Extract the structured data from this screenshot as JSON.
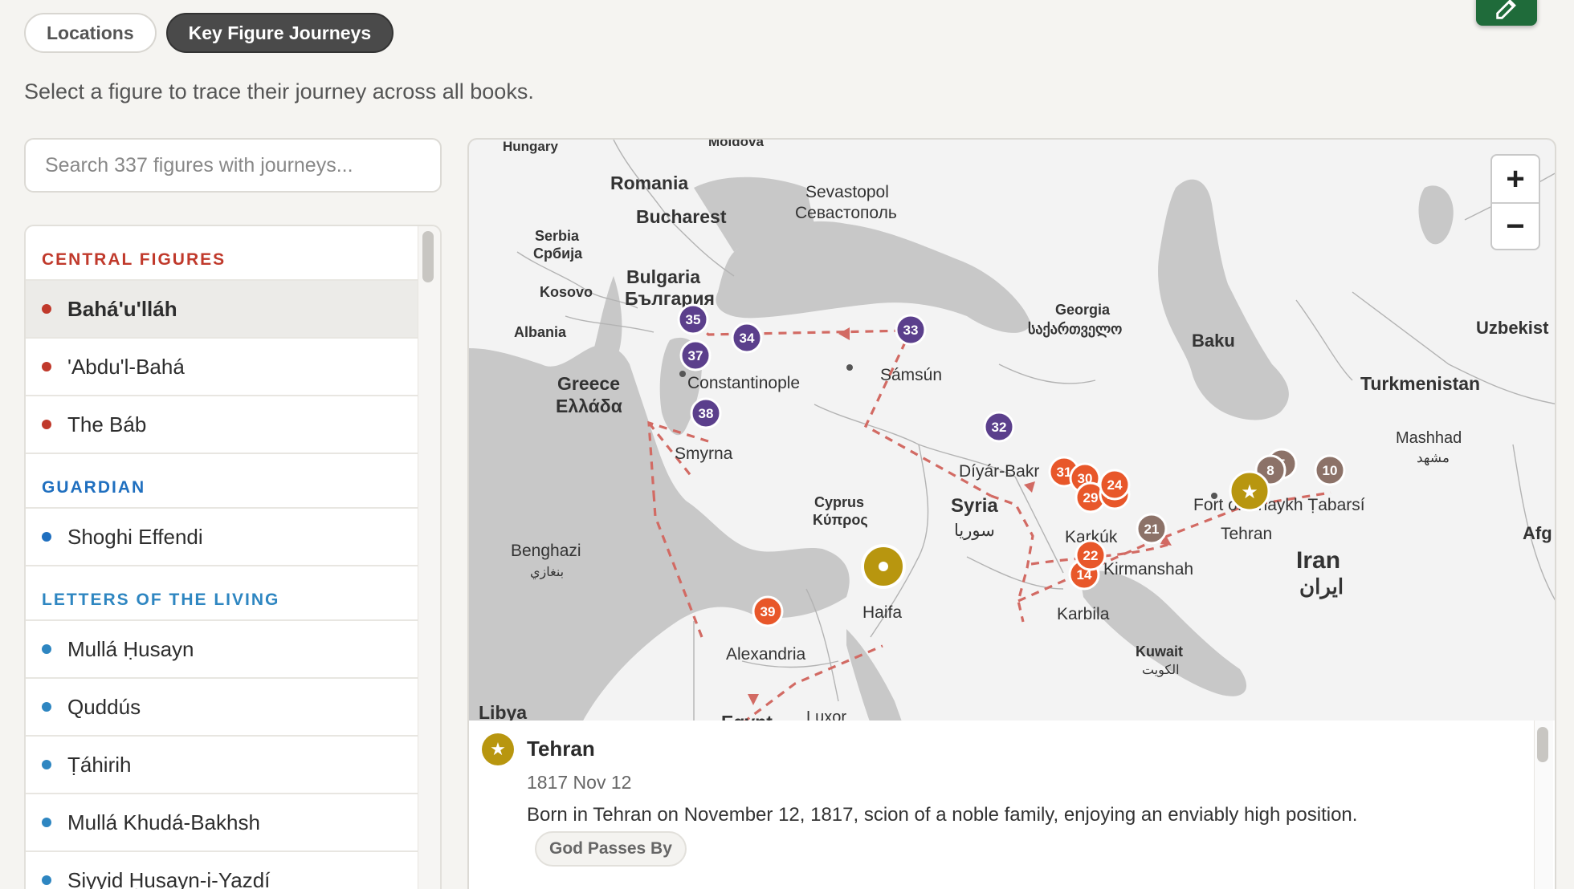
{
  "tabs": [
    {
      "label": "Locations",
      "active": false
    },
    {
      "label": "Key Figure Journeys",
      "active": true
    }
  ],
  "subtitle": "Select a figure to trace their journey across all books.",
  "search": {
    "placeholder": "Search 337 figures with journeys..."
  },
  "groups": [
    {
      "title": "CENTRAL FIGURES",
      "color": "#c0392b",
      "items": [
        "Bahá'u'lláh",
        "'Abdu'l-Bahá",
        "The Báb"
      ]
    },
    {
      "title": "GUARDIAN",
      "color": "#1f6fbf",
      "items": [
        "Shoghi Effendi"
      ]
    },
    {
      "title": "LETTERS OF THE LIVING",
      "color": "#2e86c1",
      "items": [
        "Mullá Ḥusayn",
        "Quddús",
        "Ṭáhirih",
        "Mullá Khudá-Bakhsh",
        "Siyyid Ḥusayn-i-Yazdí"
      ]
    }
  ],
  "selected_figure": "Bahá'u'lláh",
  "map": {
    "labels": {
      "hungary": "Hungary",
      "moldova": "Moldova",
      "romania": "Romania",
      "bucharest": "Bucharest",
      "sevastopol": "Sevastopol",
      "sevastopol_ru": "Севастополь",
      "serbia": "Serbia",
      "serbia_local": "Србија",
      "kosovo": "Kosovo",
      "bulgaria": "Bulgaria",
      "bulgaria_local": "България",
      "albania": "Albania",
      "greece": "Greece",
      "greece_local": "Ελλάδα",
      "constantinople": "Constantinople",
      "samsun": "Sámsún",
      "smyrna": "Smyrna",
      "georgia": "Georgia",
      "georgia_local": "საქართველო",
      "baku": "Baku",
      "uzbekistan": "Uzbekist",
      "turkmenistan": "Turkmenistan",
      "mashhad": "Mashhad",
      "mashhad_local": "مشهد",
      "diyar_bakr": "Díyár-Bakr",
      "syria": "Syria",
      "syria_local": "سوريا",
      "cyprus": "Cyprus",
      "cyprus_local": "Κύπρος",
      "benghazi": "Benghazi",
      "benghazi_local": "بنغازي",
      "haifa": "Haifa",
      "alexandria": "Alexandria",
      "karkuk": "Karkúk",
      "kirmanshah": "Kirmanshah",
      "karbila": "Karbila",
      "tehran": "Tehran",
      "fort": "Fort of Shaykh Ṭabarsí",
      "iran": "Iran",
      "iran_local": "ایران",
      "kuwait": "Kuwait",
      "kuwait_local": "الكويت",
      "libya": "Libya",
      "egypt": "Egypt",
      "luxor": "Luxor",
      "afg": "Afg"
    },
    "markers": {
      "m35": "35",
      "m34": "34",
      "m37": "37",
      "m38": "38",
      "m33": "33",
      "m32": "32",
      "m31": "31",
      "m30": "30",
      "m24": "24",
      "m29": "29",
      "m23": "23",
      "m21": "21",
      "m22": "22",
      "m14": "14",
      "m8": "8",
      "m5": "5",
      "m10": "10",
      "m39": "39"
    },
    "zoom_in": "+",
    "zoom_out": "−"
  },
  "detail": {
    "title": "Tehran",
    "date": "1817 Nov 12",
    "text": "Born in Tehran on November 12, 1817, scion of a noble family, enjoying an enviably high position.",
    "tag": "God Passes By",
    "icon": "star-icon"
  },
  "colors": {
    "accent_dark": "#4a4a4a",
    "purple_marker": "#5b3f8c",
    "orange_marker": "#e8572a",
    "brown_marker": "#8c7268",
    "gold_marker": "#b8960f",
    "route": "#d26a63",
    "edit_green": "#1f6b3a"
  }
}
